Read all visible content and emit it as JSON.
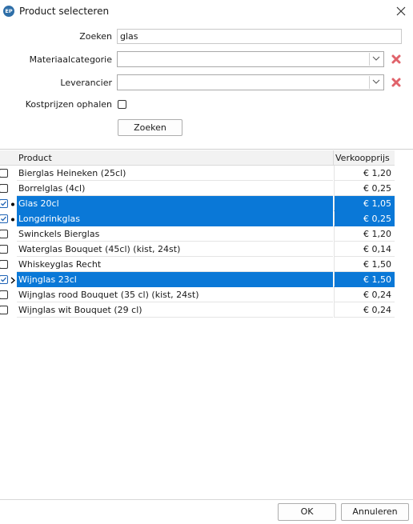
{
  "window": {
    "title": "Product selecteren",
    "icon_text": "EP",
    "close": "✕"
  },
  "form": {
    "search_label": "Zoeken",
    "search_value": "glas",
    "category_label": "Materiaalcategorie",
    "category_value": "",
    "supplier_label": "Leverancier",
    "supplier_value": "",
    "cost_label": "Kostprijzen ophalen",
    "cost_checked": false,
    "search_button": "Zoeken"
  },
  "table": {
    "columns": [
      "Product",
      "Verkoopprijs"
    ],
    "rows": [
      {
        "product": "Bierglas Heineken (25cl)",
        "price": "€ 1,20",
        "checked": false,
        "selected": false
      },
      {
        "product": "Borrelglas (4cl)",
        "price": "€ 0,25",
        "checked": false,
        "selected": false
      },
      {
        "product": "Glas 20cl",
        "price": "€ 1,05",
        "checked": true,
        "selected": true
      },
      {
        "product": "Longdrinkglas",
        "price": "€ 0,25",
        "checked": true,
        "selected": true
      },
      {
        "product": "Swinckels Bierglas",
        "price": "€ 1,20",
        "checked": false,
        "selected": false
      },
      {
        "product": "Waterglas Bouquet (45cl) (kist, 24st)",
        "price": "€ 0,14",
        "checked": false,
        "selected": false
      },
      {
        "product": "Whiskeyglas Recht",
        "price": "€ 1,50",
        "checked": false,
        "selected": false
      },
      {
        "product": "Wijnglas 23cl",
        "price": "€ 1,50",
        "checked": true,
        "selected": true
      },
      {
        "product": "Wijnglas rood Bouquet (35 cl) (kist, 24st)",
        "price": "€ 0,24",
        "checked": false,
        "selected": false
      },
      {
        "product": "Wijnglas wit Bouquet (29 cl)",
        "price": "€ 0,24",
        "checked": false,
        "selected": false
      }
    ]
  },
  "footer": {
    "ok_label": "OK",
    "cancel_label": "Annuleren"
  },
  "colors": {
    "selection": "#0a78d7",
    "clear_x": "#e0636b",
    "app_icon": "#2f6fa8"
  }
}
